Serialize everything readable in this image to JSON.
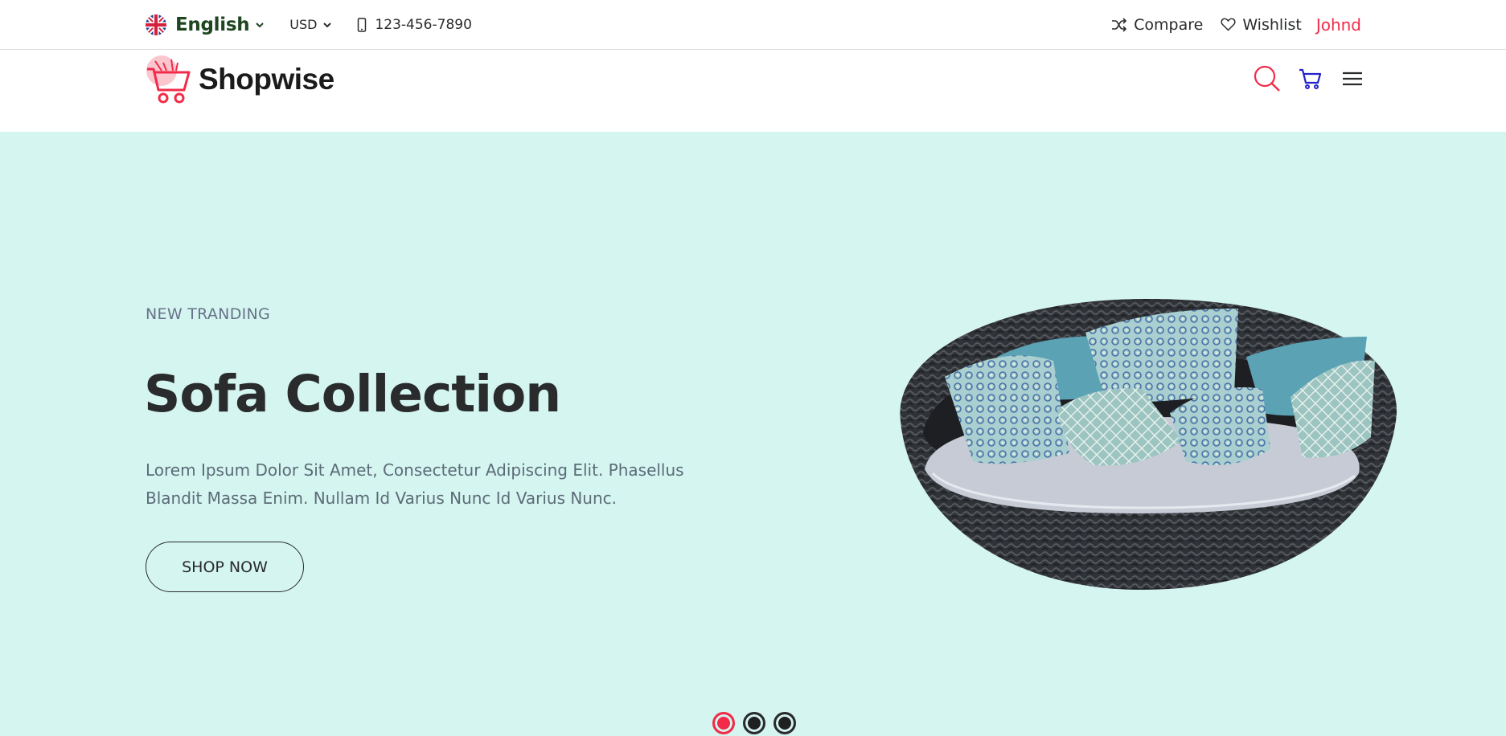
{
  "topbar": {
    "language": "English",
    "currency": "USD",
    "phone": "123-456-7890",
    "compare": "Compare",
    "wishlist": "Wishlist",
    "user": "Johnd"
  },
  "header": {
    "logo": "Shopwise"
  },
  "hero": {
    "eyebrow": "NEW TRANDING",
    "title": "Sofa Collection",
    "text": "Lorem Ipsum Dolor Sit Amet, Consectetur Adipiscing Elit. Phasellus Blandit Massa Enim. Nullam Id Varius Nunc Id Varius Nunc.",
    "button": "SHOP NOW",
    "slides": 3,
    "active_slide": 1
  },
  "icons": {
    "flag": "uk-flag-icon",
    "phone": "mobile-phone-icon",
    "compare": "shuffle-icon",
    "wishlist": "heart-icon",
    "search": "search-icon",
    "cart": "cart-icon",
    "menu": "hamburger-menu-icon"
  },
  "colors": {
    "accent": "#f12b49",
    "hero_background": "#d5f5f0",
    "cart_icon": "#2222cc",
    "language_text": "#1e4620"
  }
}
